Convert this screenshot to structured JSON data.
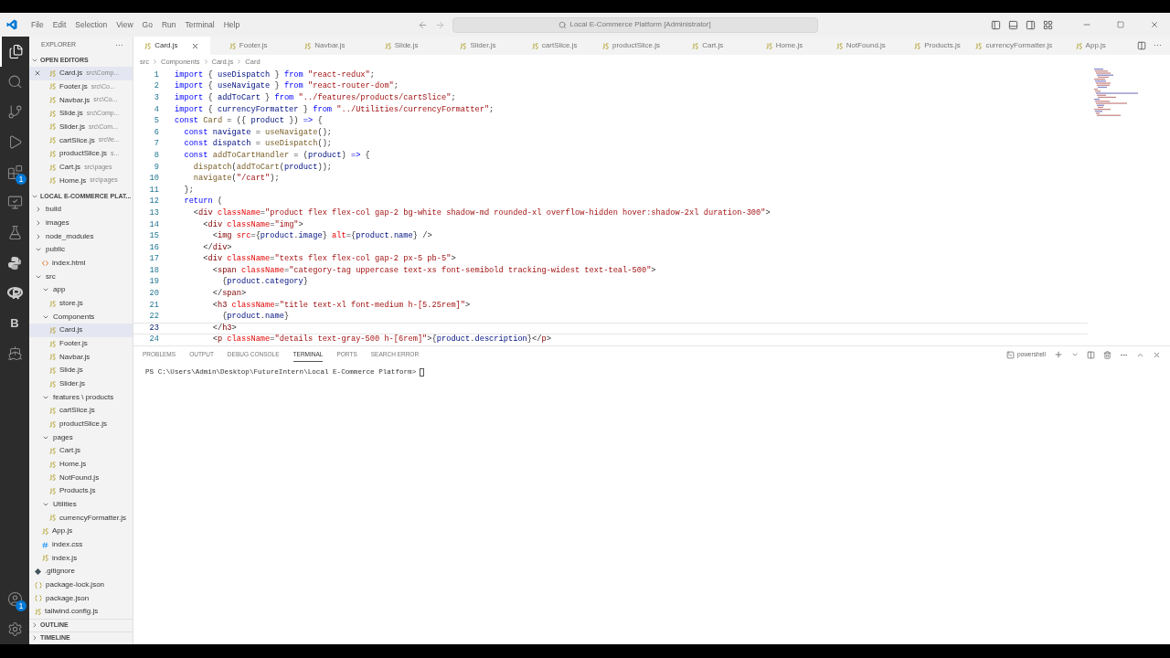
{
  "title_bar": {
    "menu": [
      "File",
      "Edit",
      "Selection",
      "View",
      "Go",
      "Run",
      "Terminal",
      "Help"
    ],
    "search": "Local E-Commerce Platform [Administrator]"
  },
  "activity_bar": {
    "items": [
      {
        "kind": "files",
        "selected": true
      },
      {
        "kind": "search",
        "selected": false
      },
      {
        "kind": "git",
        "selected": false
      },
      {
        "kind": "run",
        "selected": false
      },
      {
        "kind": "extensions",
        "selected": false,
        "badge": "1"
      },
      {
        "kind": "remote",
        "selected": false
      },
      {
        "kind": "test",
        "selected": false
      },
      {
        "kind": "python",
        "selected": false
      },
      {
        "kind": "r",
        "selected": false
      },
      {
        "kind": "letter",
        "selected": false,
        "text": "B"
      },
      {
        "kind": "docker",
        "selected": false
      }
    ],
    "bottom": [
      {
        "kind": "account",
        "badge": "1"
      },
      {
        "kind": "settings"
      }
    ]
  },
  "sidebar": {
    "title": "EXPLORER",
    "more": "···",
    "open_editors": {
      "title": "OPEN EDITORS",
      "expanded": true,
      "items": [
        {
          "name": "Card.js",
          "path": "src\\Comp...",
          "selected": true
        },
        {
          "name": "Footer.js",
          "path": "src\\Co...",
          "selected": false
        },
        {
          "name": "Navbar.js",
          "path": "src\\Co...",
          "selected": false
        },
        {
          "name": "Slide.js",
          "path": "src\\Comp...",
          "selected": false
        },
        {
          "name": "Slider.js",
          "path": "src\\Com...",
          "selected": false
        },
        {
          "name": "cartSlice.js",
          "path": "src\\fe...",
          "selected": false
        },
        {
          "name": "productSlice.js",
          "path": "s...",
          "selected": false
        },
        {
          "name": "Cart.js",
          "path": "src\\pages",
          "selected": false
        },
        {
          "name": "Home.js",
          "path": "src\\pages",
          "selected": false
        }
      ]
    },
    "project": {
      "title": "LOCAL E-COMMERCE PLAT...",
      "expanded": true,
      "items": [
        {
          "name": "build",
          "kind": "folder",
          "expanded": false
        },
        {
          "name": "images",
          "kind": "folder",
          "expanded": false
        },
        {
          "name": "node_modules",
          "kind": "folder",
          "expanded": false
        },
        {
          "name": "public",
          "kind": "folder",
          "expanded": true,
          "children": [
            {
              "name": "index.html",
              "kind": "html",
              "selected": false
            }
          ]
        },
        {
          "name": "src",
          "kind": "folder",
          "expanded": true,
          "children": [
            {
              "name": "app",
              "kind": "folder",
              "expanded": true,
              "children": [
                {
                  "name": "store.js",
                  "kind": "js",
                  "selected": false
                }
              ]
            },
            {
              "name": "Components",
              "kind": "folder",
              "expanded": true,
              "children": [
                {
                  "name": "Card.js",
                  "kind": "js",
                  "selected": true
                },
                {
                  "name": "Footer.js",
                  "kind": "js",
                  "selected": false
                },
                {
                  "name": "Navbar.js",
                  "kind": "js",
                  "selected": false
                },
                {
                  "name": "Slide.js",
                  "kind": "js",
                  "selected": false
                },
                {
                  "name": "Slider.js",
                  "kind": "js",
                  "selected": false
                }
              ]
            },
            {
              "name": "features \\ products",
              "kind": "folder",
              "expanded": true,
              "children": [
                {
                  "name": "cartSlice.js",
                  "kind": "js",
                  "selected": false
                },
                {
                  "name": "productSlice.js",
                  "kind": "js",
                  "selected": false
                }
              ]
            },
            {
              "name": "pages",
              "kind": "folder",
              "expanded": true,
              "children": [
                {
                  "name": "Cart.js",
                  "kind": "js",
                  "selected": false
                },
                {
                  "name": "Home.js",
                  "kind": "js",
                  "selected": false
                },
                {
                  "name": "NotFound.js",
                  "kind": "js",
                  "selected": false
                },
                {
                  "name": "Products.js",
                  "kind": "js",
                  "selected": false
                }
              ]
            },
            {
              "name": "Utilities",
              "kind": "folder",
              "expanded": true,
              "children": [
                {
                  "name": "currencyFormatter.js",
                  "kind": "js",
                  "selected": false
                }
              ]
            },
            {
              "name": "App.js",
              "kind": "js",
              "selected": false
            },
            {
              "name": "index.css",
              "kind": "css",
              "selected": false
            },
            {
              "name": "index.js",
              "kind": "js",
              "selected": false
            }
          ]
        },
        {
          "name": ".gitignore",
          "kind": "git",
          "selected": false
        },
        {
          "name": "package-lock.json",
          "kind": "json",
          "selected": false
        },
        {
          "name": "package.json",
          "kind": "json",
          "selected": false
        },
        {
          "name": "tailwind.config.js",
          "kind": "js",
          "selected": false
        }
      ]
    },
    "sections": [
      {
        "title": "OUTLINE",
        "expanded": false
      },
      {
        "title": "TIMELINE",
        "expanded": false
      }
    ]
  },
  "tabs": [
    {
      "label": "Card.js",
      "selected": true
    },
    {
      "label": "Footer.js",
      "selected": false
    },
    {
      "label": "Navbar.js",
      "selected": false
    },
    {
      "label": "Slide.js",
      "selected": false
    },
    {
      "label": "Slider.js",
      "selected": false
    },
    {
      "label": "cartSlice.js",
      "selected": false
    },
    {
      "label": "productSlice.js",
      "selected": false
    },
    {
      "label": "Cart.js",
      "selected": false
    },
    {
      "label": "Home.js",
      "selected": false
    },
    {
      "label": "NotFound.js",
      "selected": false
    },
    {
      "label": "Products.js",
      "selected": false
    },
    {
      "label": "currencyFormatter.js",
      "selected": false
    },
    {
      "label": "App.js",
      "selected": false
    }
  ],
  "tab_more": "···",
  "breadcrumb": [
    "src",
    "Components",
    "Card.js",
    "Card"
  ],
  "code": [
    {
      "n": "1",
      "current": false,
      "tokens": [
        {
          "kind": "kw",
          "text": "import"
        },
        {
          "kind": "p",
          "text": " { "
        },
        {
          "kind": "var",
          "text": "useDispatch"
        },
        {
          "kind": "p",
          "text": " } "
        },
        {
          "kind": "kw",
          "text": "from"
        },
        {
          "kind": "str",
          "text": " \"react-redux\""
        },
        {
          "kind": "p",
          "text": ";"
        }
      ]
    },
    {
      "n": "2",
      "current": false,
      "tokens": [
        {
          "kind": "kw",
          "text": "import"
        },
        {
          "kind": "p",
          "text": " { "
        },
        {
          "kind": "var",
          "text": "useNavigate"
        },
        {
          "kind": "p",
          "text": " } "
        },
        {
          "kind": "kw",
          "text": "from"
        },
        {
          "kind": "str",
          "text": " \"react-router-dom\""
        },
        {
          "kind": "p",
          "text": ";"
        }
      ]
    },
    {
      "n": "3",
      "current": false,
      "tokens": [
        {
          "kind": "kw",
          "text": "import"
        },
        {
          "kind": "p",
          "text": " { "
        },
        {
          "kind": "var",
          "text": "addToCart"
        },
        {
          "kind": "p",
          "text": " } "
        },
        {
          "kind": "kw",
          "text": "from"
        },
        {
          "kind": "str",
          "text": " \"../features/products/cartSlice\""
        },
        {
          "kind": "p",
          "text": ";"
        }
      ]
    },
    {
      "n": "4",
      "current": false,
      "tokens": [
        {
          "kind": "kw",
          "text": "import"
        },
        {
          "kind": "p",
          "text": " { "
        },
        {
          "kind": "var",
          "text": "currencyFormatter"
        },
        {
          "kind": "p",
          "text": " } "
        },
        {
          "kind": "kw",
          "text": "from"
        },
        {
          "kind": "str",
          "text": " \"../Utilities/currencyFormatter\""
        },
        {
          "kind": "p",
          "text": ";"
        }
      ]
    },
    {
      "n": "5",
      "current": false,
      "tokens": [
        {
          "kind": "kw",
          "text": "const"
        },
        {
          "kind": "fn",
          "text": " Card"
        },
        {
          "kind": "p",
          "text": " = ({ "
        },
        {
          "kind": "var",
          "text": "product"
        },
        {
          "kind": "p",
          "text": " }) "
        },
        {
          "kind": "kw",
          "text": "=>"
        },
        {
          "kind": "p",
          "text": " {"
        }
      ]
    },
    {
      "n": "6",
      "current": false,
      "tokens": [
        {
          "kind": "kw",
          "text": "  const"
        },
        {
          "kind": "var",
          "text": " navigate"
        },
        {
          "kind": "p",
          "text": " = "
        },
        {
          "kind": "fn",
          "text": "useNavigate"
        },
        {
          "kind": "p",
          "text": "();"
        }
      ]
    },
    {
      "n": "7",
      "current": false,
      "tokens": [
        {
          "kind": "kw",
          "text": "  const"
        },
        {
          "kind": "var",
          "text": " dispatch"
        },
        {
          "kind": "p",
          "text": " = "
        },
        {
          "kind": "fn",
          "text": "useDispatch"
        },
        {
          "kind": "p",
          "text": "();"
        }
      ]
    },
    {
      "n": "8",
      "current": false,
      "tokens": [
        {
          "kind": "kw",
          "text": "  const"
        },
        {
          "kind": "fn",
          "text": " addToCartHandler"
        },
        {
          "kind": "p",
          "text": " = ("
        },
        {
          "kind": "var",
          "text": "product"
        },
        {
          "kind": "p",
          "text": ") "
        },
        {
          "kind": "kw",
          "text": "=>"
        },
        {
          "kind": "p",
          "text": " {"
        }
      ]
    },
    {
      "n": "9",
      "current": false,
      "tokens": [
        {
          "kind": "fn",
          "text": "    dispatch"
        },
        {
          "kind": "p",
          "text": "("
        },
        {
          "kind": "fn",
          "text": "addToCart"
        },
        {
          "kind": "p",
          "text": "("
        },
        {
          "kind": "var",
          "text": "product"
        },
        {
          "kind": "p",
          "text": "));"
        }
      ]
    },
    {
      "n": "10",
      "current": false,
      "tokens": [
        {
          "kind": "fn",
          "text": "    navigate"
        },
        {
          "kind": "p",
          "text": "("
        },
        {
          "kind": "str",
          "text": "\"/cart\""
        },
        {
          "kind": "p",
          "text": ");"
        }
      ]
    },
    {
      "n": "11",
      "current": false,
      "tokens": [
        {
          "kind": "p",
          "text": "  };"
        }
      ]
    },
    {
      "n": "12",
      "current": false,
      "tokens": [
        {
          "kind": "kw",
          "text": "  return"
        },
        {
          "kind": "p",
          "text": " ("
        }
      ]
    },
    {
      "n": "13",
      "current": false,
      "tokens": [
        {
          "kind": "p",
          "text": "    <"
        },
        {
          "kind": "tag",
          "text": "div"
        },
        {
          "kind": "attr",
          "text": " className"
        },
        {
          "kind": "p",
          "text": "="
        },
        {
          "kind": "str",
          "text": "\"product flex flex-col gap-2 bg-white shadow-md rounded-xl overflow-hidden hover:shadow-2xl duration-300\""
        },
        {
          "kind": "p",
          "text": ">"
        }
      ]
    },
    {
      "n": "14",
      "current": false,
      "tokens": [
        {
          "kind": "p",
          "text": "      <"
        },
        {
          "kind": "tag",
          "text": "div"
        },
        {
          "kind": "attr",
          "text": " className"
        },
        {
          "kind": "p",
          "text": "="
        },
        {
          "kind": "str",
          "text": "\"img\""
        },
        {
          "kind": "p",
          "text": ">"
        }
      ]
    },
    {
      "n": "15",
      "current": false,
      "tokens": [
        {
          "kind": "p",
          "text": "        <"
        },
        {
          "kind": "tag",
          "text": "img"
        },
        {
          "kind": "attr",
          "text": " src"
        },
        {
          "kind": "p",
          "text": "={"
        },
        {
          "kind": "var",
          "text": "product"
        },
        {
          "kind": "p",
          "text": "."
        },
        {
          "kind": "var",
          "text": "image"
        },
        {
          "kind": "p",
          "text": "} "
        },
        {
          "kind": "attr",
          "text": "alt"
        },
        {
          "kind": "p",
          "text": "={"
        },
        {
          "kind": "var",
          "text": "product"
        },
        {
          "kind": "p",
          "text": "."
        },
        {
          "kind": "var",
          "text": "name"
        },
        {
          "kind": "p",
          "text": "} />"
        }
      ]
    },
    {
      "n": "16",
      "current": false,
      "tokens": [
        {
          "kind": "p",
          "text": "      </"
        },
        {
          "kind": "tag",
          "text": "div"
        },
        {
          "kind": "p",
          "text": ">"
        }
      ]
    },
    {
      "n": "17",
      "current": false,
      "tokens": [
        {
          "kind": "p",
          "text": "      <"
        },
        {
          "kind": "tag",
          "text": "div"
        },
        {
          "kind": "attr",
          "text": " className"
        },
        {
          "kind": "p",
          "text": "="
        },
        {
          "kind": "str",
          "text": "\"texts flex flex-col gap-2 px-5 pb-5\""
        },
        {
          "kind": "p",
          "text": ">"
        }
      ]
    },
    {
      "n": "18",
      "current": false,
      "tokens": [
        {
          "kind": "p",
          "text": "        <"
        },
        {
          "kind": "tag",
          "text": "span"
        },
        {
          "kind": "attr",
          "text": " className"
        },
        {
          "kind": "p",
          "text": "="
        },
        {
          "kind": "str",
          "text": "\"category-tag uppercase text-xs font-semibold tracking-widest text-teal-500\""
        },
        {
          "kind": "p",
          "text": ">"
        }
      ]
    },
    {
      "n": "19",
      "current": false,
      "tokens": [
        {
          "kind": "p",
          "text": "          {"
        },
        {
          "kind": "var",
          "text": "product"
        },
        {
          "kind": "p",
          "text": "."
        },
        {
          "kind": "var",
          "text": "category"
        },
        {
          "kind": "p",
          "text": "}"
        }
      ]
    },
    {
      "n": "20",
      "current": false,
      "tokens": [
        {
          "kind": "p",
          "text": "        </"
        },
        {
          "kind": "tag",
          "text": "span"
        },
        {
          "kind": "p",
          "text": ">"
        }
      ]
    },
    {
      "n": "21",
      "current": false,
      "tokens": [
        {
          "kind": "p",
          "text": "        <"
        },
        {
          "kind": "tag",
          "text": "h3"
        },
        {
          "kind": "attr",
          "text": " className"
        },
        {
          "kind": "p",
          "text": "="
        },
        {
          "kind": "str",
          "text": "\"title text-xl font-medium h-[5.25rem]\""
        },
        {
          "kind": "p",
          "text": ">"
        }
      ]
    },
    {
      "n": "22",
      "current": false,
      "tokens": [
        {
          "kind": "p",
          "text": "          {"
        },
        {
          "kind": "var",
          "text": "product"
        },
        {
          "kind": "p",
          "text": "."
        },
        {
          "kind": "var",
          "text": "name"
        },
        {
          "kind": "p",
          "text": "}"
        }
      ]
    },
    {
      "n": "23",
      "current": true,
      "tokens": [
        {
          "kind": "p",
          "text": "        </"
        },
        {
          "kind": "tag",
          "text": "h3"
        },
        {
          "kind": "p",
          "text": ">"
        }
      ]
    },
    {
      "n": "24",
      "current": false,
      "tokens": [
        {
          "kind": "p",
          "text": "        <"
        },
        {
          "kind": "tag",
          "text": "p"
        },
        {
          "kind": "attr",
          "text": " className"
        },
        {
          "kind": "p",
          "text": "="
        },
        {
          "kind": "str",
          "text": "\"details text-gray-500 h-[6rem]\""
        },
        {
          "kind": "p",
          "text": ">{"
        },
        {
          "kind": "var",
          "text": "product"
        },
        {
          "kind": "p",
          "text": "."
        },
        {
          "kind": "var",
          "text": "description"
        },
        {
          "kind": "p",
          "text": "}</"
        },
        {
          "kind": "tag",
          "text": "p"
        },
        {
          "kind": "p",
          "text": ">"
        }
      ]
    }
  ],
  "panel": {
    "tabs": [
      {
        "label": "PROBLEMS",
        "selected": false
      },
      {
        "label": "OUTPUT",
        "selected": false
      },
      {
        "label": "DEBUG CONSOLE",
        "selected": false
      },
      {
        "label": "TERMINAL",
        "selected": true
      },
      {
        "label": "PORTS",
        "selected": false
      },
      {
        "label": "SEARCH ERROR",
        "selected": false
      }
    ],
    "terminal_name": "powershell",
    "prompt": "PS C:\\Users\\Admin\\Desktop\\FutureIntern\\Local E-Commerce Platform>"
  }
}
